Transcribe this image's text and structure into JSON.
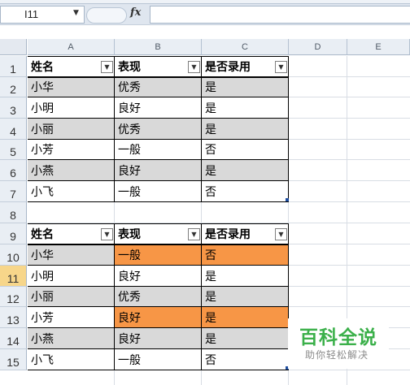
{
  "formula_bar": {
    "name_box": "I11",
    "fx_label": "fx",
    "formula": ""
  },
  "columns": [
    "A",
    "B",
    "C",
    "D",
    "E"
  ],
  "rows": [
    "1",
    "2",
    "3",
    "4",
    "5",
    "6",
    "7",
    "8",
    "9",
    "10",
    "11",
    "12",
    "13",
    "14",
    "15"
  ],
  "active_row": "11",
  "table1": {
    "headers": [
      "姓名",
      "表现",
      "是否录用"
    ],
    "rows": [
      {
        "name": "小华",
        "perf": "优秀",
        "hire": "是"
      },
      {
        "name": "小明",
        "perf": "良好",
        "hire": "是"
      },
      {
        "name": "小丽",
        "perf": "优秀",
        "hire": "是"
      },
      {
        "name": "小芳",
        "perf": "一般",
        "hire": "否"
      },
      {
        "name": "小燕",
        "perf": "良好",
        "hire": "是"
      },
      {
        "name": "小飞",
        "perf": "一般",
        "hire": "否"
      }
    ]
  },
  "table2": {
    "headers": [
      "姓名",
      "表现",
      "是否录用"
    ],
    "rows": [
      {
        "name": "小华",
        "perf": "一般",
        "hire": "否"
      },
      {
        "name": "小明",
        "perf": "良好",
        "hire": "是"
      },
      {
        "name": "小丽",
        "perf": "优秀",
        "hire": "是"
      },
      {
        "name": "小芳",
        "perf": "良好",
        "hire": "是"
      },
      {
        "name": "小燕",
        "perf": "良好",
        "hire": "是"
      },
      {
        "name": "小飞",
        "perf": "一般",
        "hire": "否"
      }
    ],
    "highlighted_rows": [
      0,
      3
    ],
    "highlight_color": "#f79646"
  },
  "colors": {
    "stripe": "#d9d9d9",
    "active_row_header": "#f7d68a"
  },
  "watermark": {
    "title": "百科全说",
    "subtitle": "助你轻松解决"
  }
}
